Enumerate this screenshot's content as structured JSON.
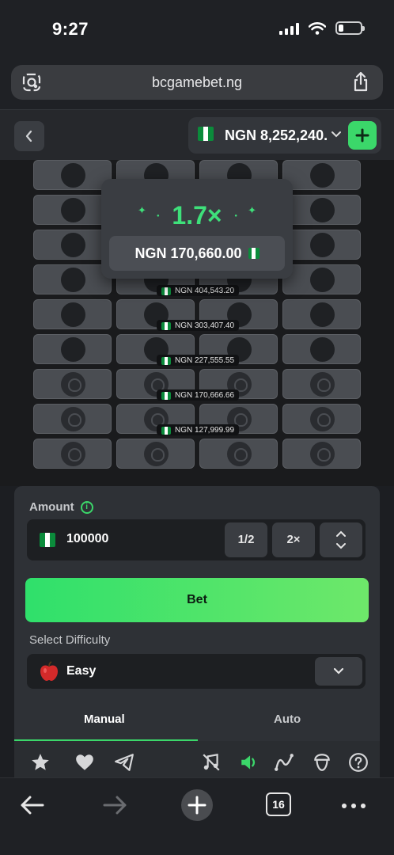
{
  "status": {
    "time": "9:27"
  },
  "browser": {
    "url": "bcgamebet.ng",
    "tabs_count": "16"
  },
  "header": {
    "balance": "NGN 8,252,240.",
    "back_icon": "chevron-left-icon",
    "add_icon": "plus-icon"
  },
  "popup": {
    "multiplier": "1.7×",
    "win_amount": "NGN 170,660.00"
  },
  "board": {
    "multipliers": [
      "NGN 404,543.20",
      "NGN 303,407.40",
      "NGN 227,555.55",
      "NGN 170,666.66",
      "NGN 127,999.99"
    ]
  },
  "controls": {
    "amount_label": "Amount",
    "amount_value": "100000",
    "half_label": "1/2",
    "double_label": "2×",
    "bet_label": "Bet",
    "difficulty_label": "Select Difficulty",
    "difficulty_value": "Easy",
    "tab_manual": "Manual",
    "tab_auto": "Auto"
  },
  "colors": {
    "accent": "#3bd76a",
    "panel": "#2e3136",
    "background": "#1c1e22"
  }
}
